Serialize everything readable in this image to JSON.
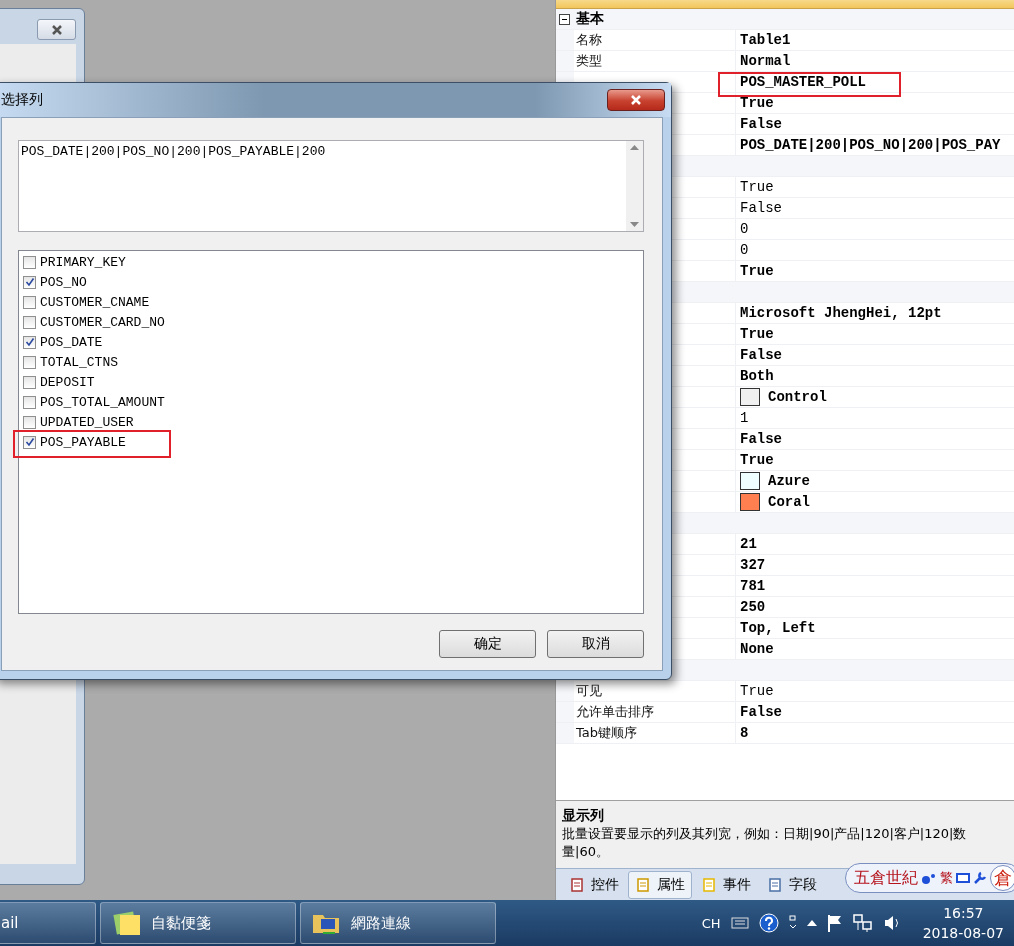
{
  "properties": {
    "groups": [
      {
        "label": "基本",
        "expanded": true,
        "rows": [
          {
            "name": "名称",
            "value": "Table1",
            "modified": true,
            "highlighted": false
          },
          {
            "name": "类型",
            "value": "Normal",
            "modified": true,
            "highlighted": false
          },
          {
            "value": "POS_MASTER_POLL",
            "modified": true,
            "highlighted": true
          },
          {
            "value": "True",
            "modified": true,
            "highlighted": false
          },
          {
            "value": "False",
            "modified": true,
            "highlighted": false
          },
          {
            "value": "POS_DATE|200|POS_NO|200|POS_PAY",
            "modified": true,
            "highlighted": false
          }
        ]
      },
      {
        "rows": [
          {
            "value": "True",
            "modified": false,
            "highlighted": false
          },
          {
            "value": "False",
            "modified": false,
            "highlighted": false
          },
          {
            "value": "0",
            "modified": false,
            "highlighted": false
          },
          {
            "value": "0",
            "modified": false,
            "highlighted": false
          },
          {
            "value": "True",
            "modified": true,
            "highlighted": false
          }
        ]
      },
      {
        "rows": [
          {
            "value": "Microsoft JhengHei, 12pt",
            "modified": true,
            "highlighted": false
          },
          {
            "value": "True",
            "modified": true,
            "highlighted": false
          },
          {
            "value": "False",
            "modified": true,
            "highlighted": false
          },
          {
            "value": "Both",
            "modified": true,
            "highlighted": false
          },
          {
            "value": "Control",
            "modified": true,
            "highlighted": false,
            "color": "#f0f0f0"
          },
          {
            "value": "1",
            "modified": false,
            "highlighted": false
          },
          {
            "value": "False",
            "modified": true,
            "highlighted": false
          },
          {
            "value": "True",
            "modified": true,
            "highlighted": false
          },
          {
            "value": "Azure",
            "modified": true,
            "highlighted": false,
            "color": "#f0ffff"
          },
          {
            "value": "Coral",
            "modified": true,
            "highlighted": false,
            "color": "#ff7f50"
          }
        ]
      },
      {
        "rows": [
          {
            "value": "21",
            "modified": true,
            "highlighted": false
          },
          {
            "value": "327",
            "modified": true,
            "highlighted": false
          },
          {
            "value": "781",
            "modified": true,
            "highlighted": false
          },
          {
            "value": "250",
            "modified": true,
            "highlighted": false
          },
          {
            "value": "Top, Left",
            "modified": true,
            "highlighted": false
          },
          {
            "value": "None",
            "modified": true,
            "highlighted": false
          }
        ]
      },
      {
        "rows": [
          {
            "name": "可见",
            "value": "True",
            "modified": false,
            "highlighted": false
          },
          {
            "name": "允许单击排序",
            "value": "False",
            "modified": true,
            "highlighted": false
          },
          {
            "name": "Tab键顺序",
            "value": "8",
            "modified": true,
            "highlighted": false
          }
        ]
      }
    ],
    "description": {
      "title": "显示列",
      "text": "批量设置要显示的列及其列宽，例如：日期|90|产品|120|客户|120|数量|60。"
    },
    "tabs": [
      {
        "label": "控件",
        "selected": false
      },
      {
        "label": "属性",
        "selected": true
      },
      {
        "label": "事件",
        "selected": false
      },
      {
        "label": "字段",
        "selected": false
      }
    ]
  },
  "ime_bar": {
    "name": "五倉世紀",
    "mode": "繁",
    "logo": "倉"
  },
  "dialog": {
    "title": "选择列",
    "text_value": "POS_DATE|200|POS_NO|200|POS_PAYABLE|200",
    "columns": [
      {
        "label": "PRIMARY_KEY",
        "checked": false,
        "highlighted": false
      },
      {
        "label": "POS_NO",
        "checked": true,
        "highlighted": false
      },
      {
        "label": "CUSTOMER_CNAME",
        "checked": false,
        "highlighted": false
      },
      {
        "label": "CUSTOMER_CARD_NO",
        "checked": false,
        "highlighted": false
      },
      {
        "label": "POS_DATE",
        "checked": true,
        "highlighted": false
      },
      {
        "label": "TOTAL_CTNS",
        "checked": false,
        "highlighted": false
      },
      {
        "label": "DEPOSIT",
        "checked": false,
        "highlighted": false
      },
      {
        "label": "POS_TOTAL_AMOUNT",
        "checked": false,
        "highlighted": false
      },
      {
        "label": "UPDATED_USER",
        "checked": false,
        "highlighted": false
      },
      {
        "label": "POS_PAYABLE",
        "checked": true,
        "highlighted": true
      }
    ],
    "buttons": [
      "确定",
      "取消"
    ]
  },
  "taskbar": {
    "tasks": [
      {
        "label": "ail"
      },
      {
        "label": "自黏便箋"
      },
      {
        "label": "網路連線"
      }
    ],
    "tray": {
      "language": "CH",
      "time": "16:57",
      "date": "2018-08-07"
    }
  }
}
